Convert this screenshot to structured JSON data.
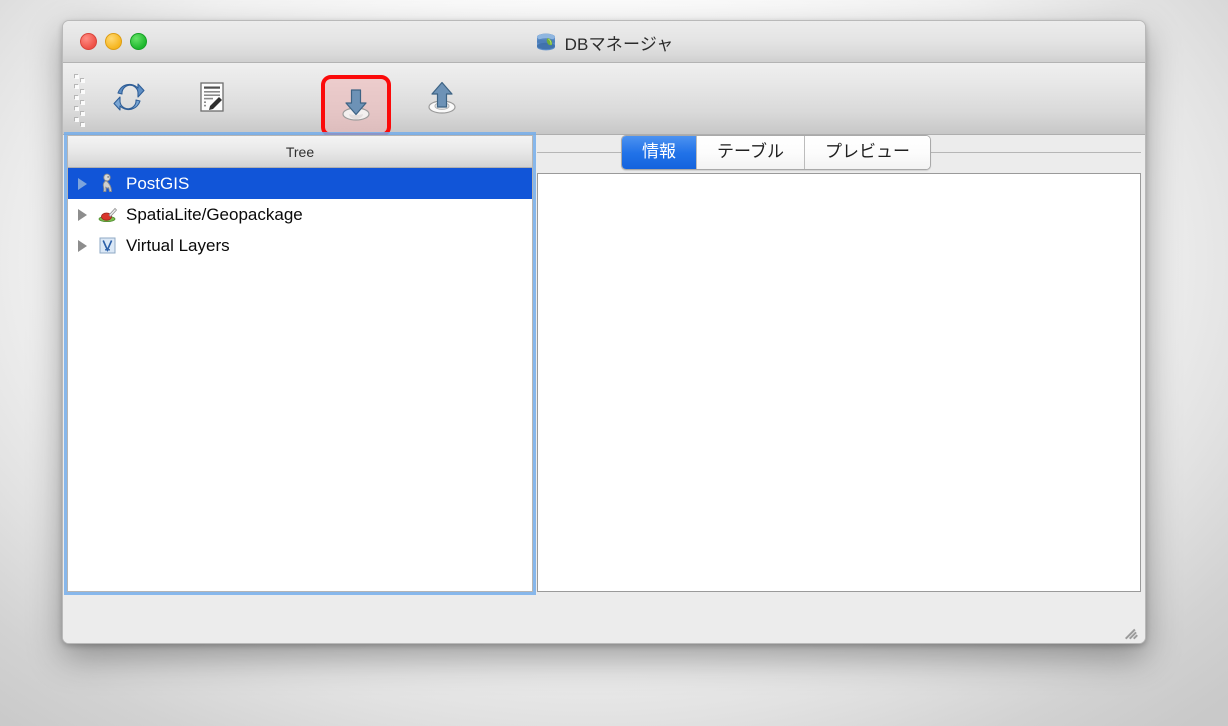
{
  "window": {
    "title": "DBマネージャ",
    "title_icon": "database-icon",
    "traffic_lights": [
      {
        "name": "close",
        "color": "#ef5248"
      },
      {
        "name": "minimize",
        "color": "#f6b61f"
      },
      {
        "name": "zoom",
        "color": "#1fb82e"
      }
    ]
  },
  "toolbar": {
    "drag_handle": "toolbar-drag-handle",
    "buttons": [
      {
        "name": "refresh-button",
        "icon": "refresh-icon",
        "highlighted": false
      },
      {
        "name": "sql-window-button",
        "icon": "sql-document-icon",
        "highlighted": false
      },
      {
        "name": "import-layer-button",
        "icon": "import-down-arrow-icon",
        "highlighted": true,
        "highlight_color": "#fb0a0a"
      },
      {
        "name": "export-layer-button",
        "icon": "export-up-arrow-icon",
        "highlighted": false
      }
    ]
  },
  "tree": {
    "header": "Tree",
    "items": [
      {
        "label": "PostGIS",
        "icon": "postgis-elephant-icon",
        "selected": true,
        "expanded": false
      },
      {
        "label": "SpatiaLite/Geopackage",
        "icon": "spatialite-icon",
        "selected": false,
        "expanded": false
      },
      {
        "label": "Virtual Layers",
        "icon": "virtual-layers-icon",
        "selected": false,
        "expanded": false
      }
    ],
    "selection_color": "#1155d8"
  },
  "right_panel": {
    "tabs": [
      {
        "label": "情報",
        "active": true
      },
      {
        "label": "テーブル",
        "active": false
      },
      {
        "label": "プレビュー",
        "active": false
      }
    ],
    "content": ""
  },
  "status": {
    "resize_grip": "resize-grip"
  }
}
